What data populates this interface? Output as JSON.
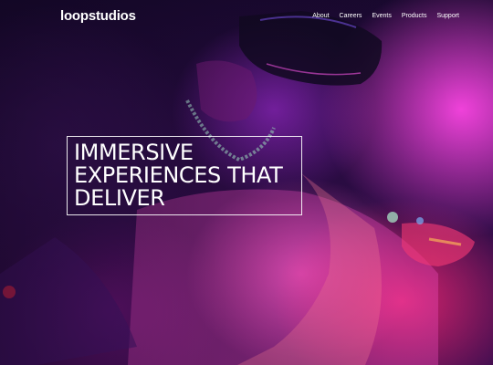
{
  "header": {
    "logo": "loopstudios",
    "nav": [
      {
        "label": "About"
      },
      {
        "label": "Careers"
      },
      {
        "label": "Events"
      },
      {
        "label": "Products"
      },
      {
        "label": "Support"
      }
    ]
  },
  "hero": {
    "headline_lines": [
      "IMMERSIVE",
      "EXPERIENCES THAT",
      "DELIVER"
    ],
    "background_image": "person wearing VR headset lit with magenta and purple light"
  },
  "colors": {
    "text": "#ffffff",
    "accent_magenta": "#ff46e6",
    "accent_pink": "#ff2878",
    "dark_purple": "#1a0930"
  }
}
